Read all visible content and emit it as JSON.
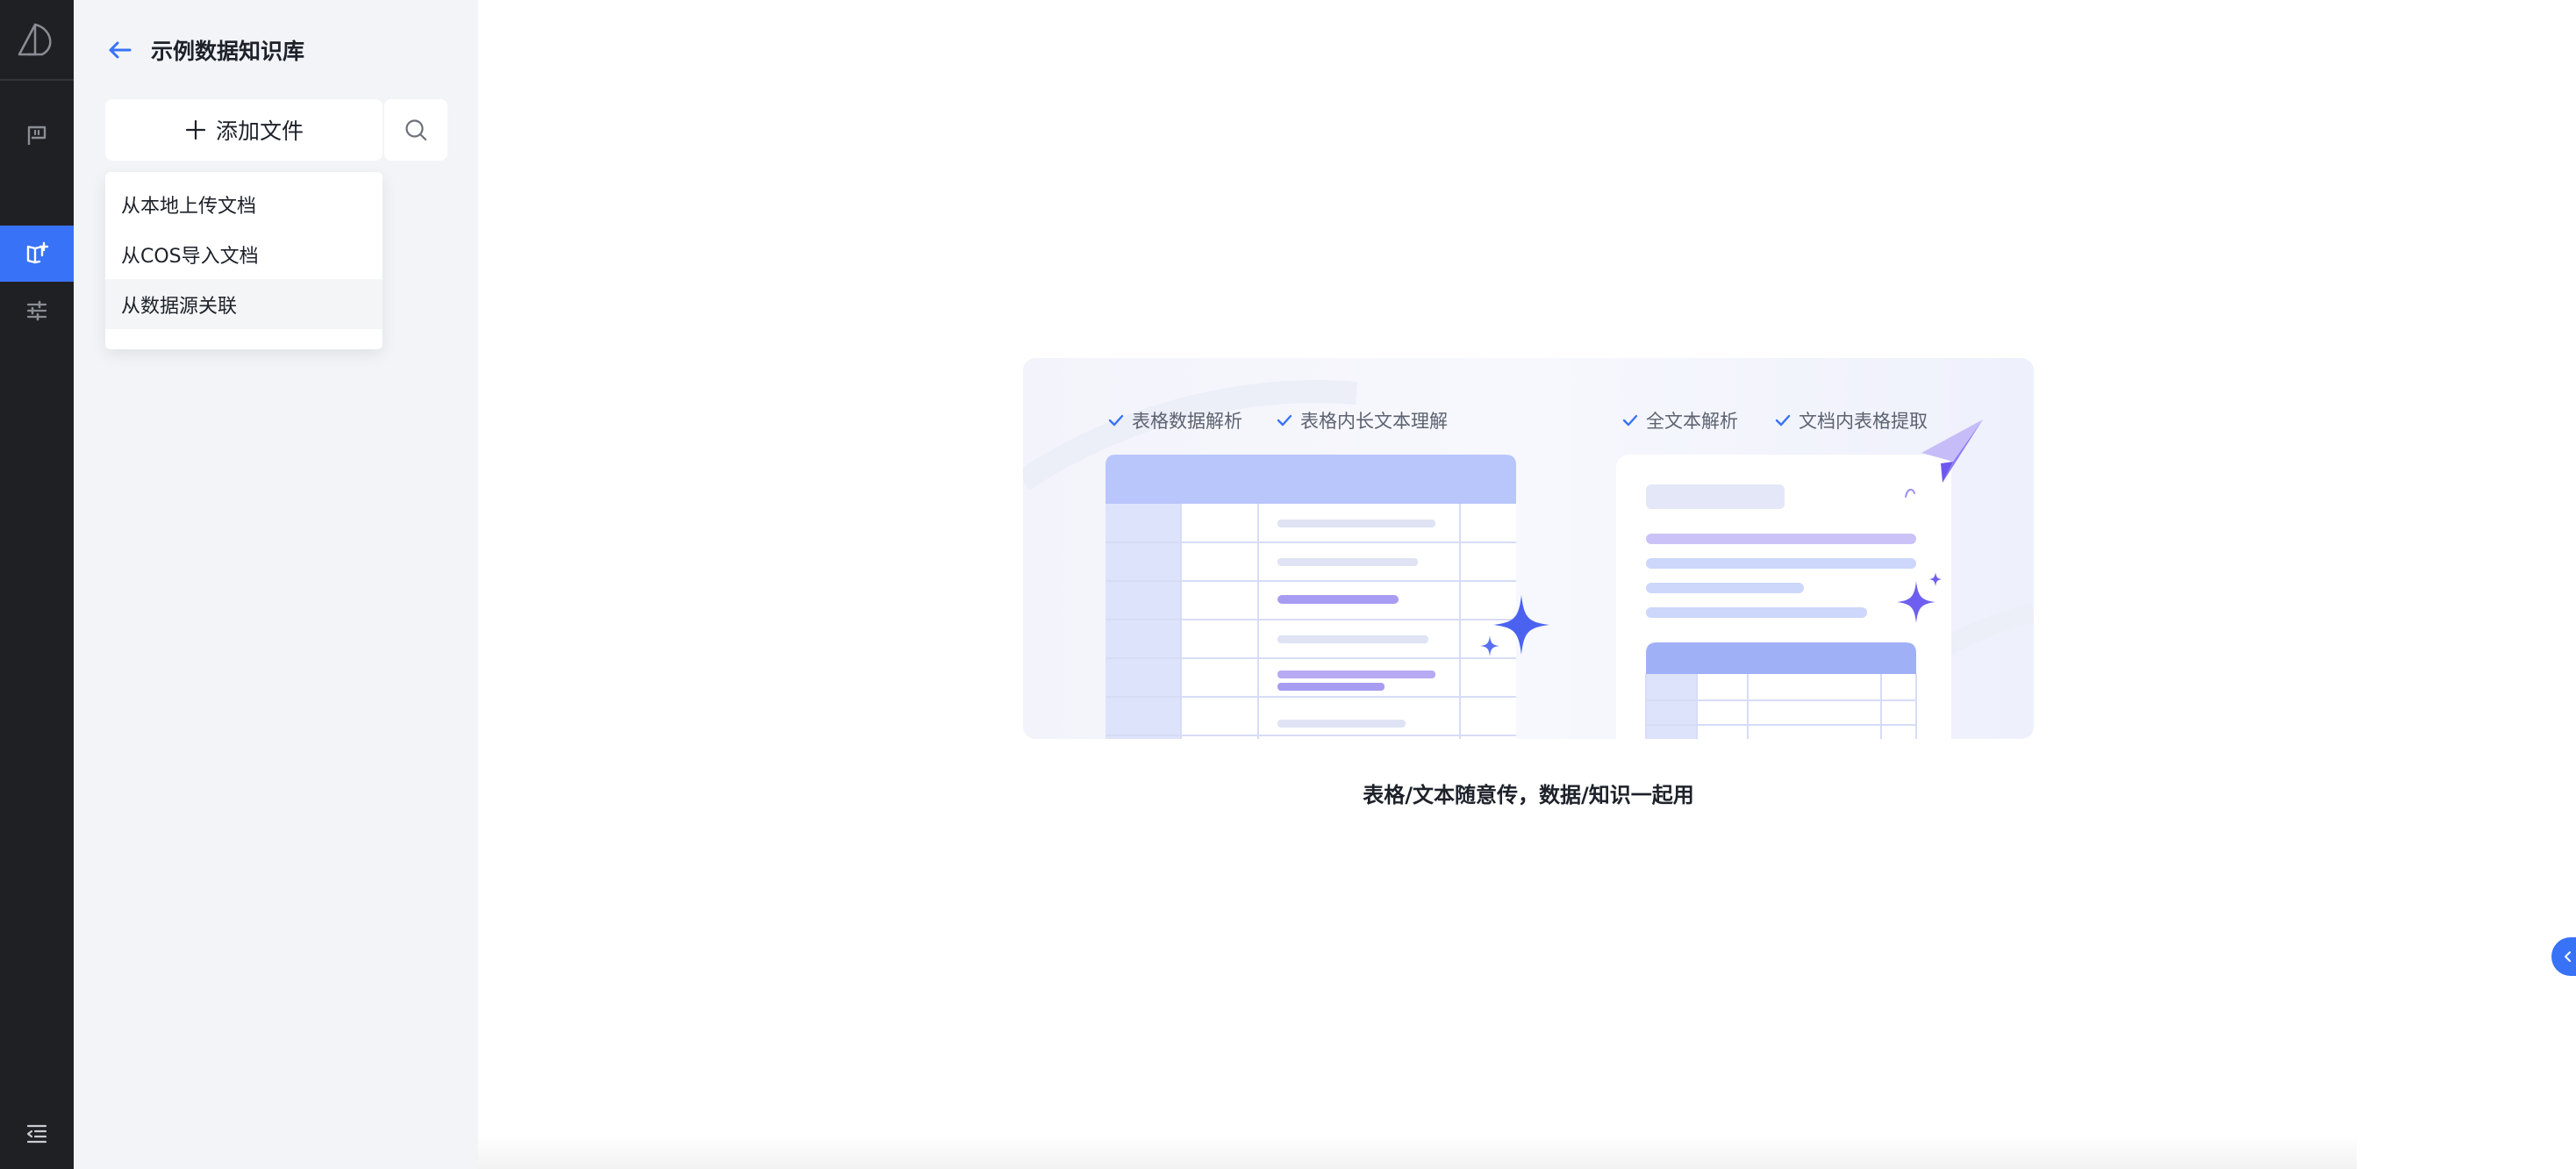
{
  "rail": {
    "items": [
      {
        "id": "logo",
        "icon": "brand-logo-icon"
      },
      {
        "id": "chat",
        "icon": "chat-flag-icon"
      },
      {
        "id": "knowledge",
        "icon": "knowledge-book-icon",
        "active": true
      },
      {
        "id": "tune",
        "icon": "sliders-icon"
      },
      {
        "id": "collapse",
        "icon": "menu-collapse-icon"
      }
    ],
    "active_color": "#3872f6"
  },
  "panel": {
    "title": "示例数据知识库",
    "add_button_label": "添加文件",
    "dropdown": {
      "items": [
        {
          "label": "从本地上传文档"
        },
        {
          "label": "从COS导入文档"
        },
        {
          "label": "从数据源关联"
        }
      ]
    }
  },
  "main": {
    "features_left": [
      "表格数据解析",
      "表格内长文本理解"
    ],
    "features_right": [
      "全文本解析",
      "文档内表格提取"
    ],
    "tagline": "表格/文本随意传，数据/知识一起用"
  },
  "colors": {
    "accent": "#3872f6",
    "rail_bg": "#1f2024",
    "panel_bg": "#f2f4f8"
  }
}
